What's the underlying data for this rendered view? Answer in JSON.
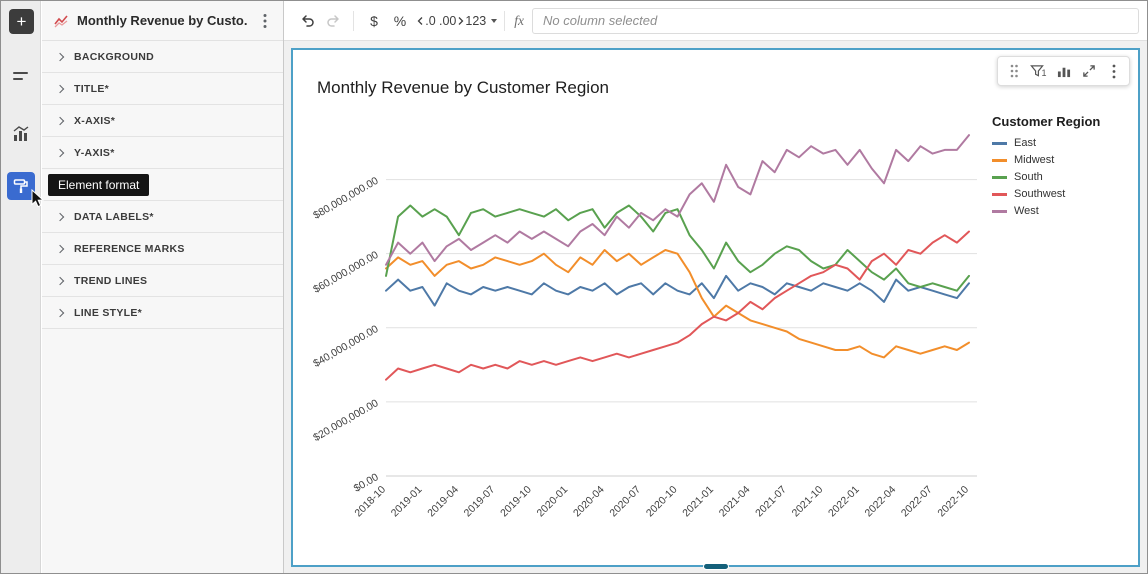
{
  "rail": {
    "add_label": "+",
    "tooltip": "Element format"
  },
  "panel": {
    "title": "Monthly Revenue by Custo...",
    "sections": [
      {
        "label": "BACKGROUND"
      },
      {
        "label": "TITLE*"
      },
      {
        "label": "X-AXIS*"
      },
      {
        "label": "Y-AXIS*"
      },
      {
        "label": ""
      },
      {
        "label": "DATA LABELS*"
      },
      {
        "label": "REFERENCE MARKS"
      },
      {
        "label": "TREND LINES"
      },
      {
        "label": "LINE STYLE*"
      }
    ]
  },
  "toolbar": {
    "currency_label": "$",
    "percent_label": "%",
    "decimal_decrease_label": ".0",
    "decimal_increase_label": ".00",
    "number_format_label": "123",
    "fx_label": "fx",
    "formula_placeholder": "No column selected"
  },
  "float_toolbar": {
    "filter_count": "1"
  },
  "colors": {
    "accent_blue": "#3a6bd0",
    "selection_border": "#4da0c7",
    "tooltip_bg": "#141414"
  },
  "chart_data": {
    "type": "line",
    "title": "Monthly Revenue by Customer Region",
    "legend_title": "Customer Region",
    "legend_position": "right",
    "grid": "horizontal",
    "x_tick_every": 3,
    "x_label_rotation": -45,
    "y_label_rotation": -30,
    "values_unit": "USD millions",
    "ylim": [
      0,
      95
    ],
    "x": [
      "2018-10",
      "2018-11",
      "2018-12",
      "2019-01",
      "2019-02",
      "2019-03",
      "2019-04",
      "2019-05",
      "2019-06",
      "2019-07",
      "2019-08",
      "2019-09",
      "2019-10",
      "2019-11",
      "2019-12",
      "2020-01",
      "2020-02",
      "2020-03",
      "2020-04",
      "2020-05",
      "2020-06",
      "2020-07",
      "2020-08",
      "2020-09",
      "2020-10",
      "2020-11",
      "2020-12",
      "2021-01",
      "2021-02",
      "2021-03",
      "2021-04",
      "2021-05",
      "2021-06",
      "2021-07",
      "2021-08",
      "2021-09",
      "2021-10",
      "2021-11",
      "2021-12",
      "2022-01",
      "2022-02",
      "2022-03",
      "2022-04",
      "2022-05",
      "2022-06",
      "2022-07",
      "2022-08",
      "2022-09",
      "2022-10"
    ],
    "y_ticks": [
      {
        "value": 0,
        "label": "$0.00"
      },
      {
        "value": 20,
        "label": "$20,000,000.00"
      },
      {
        "value": 40,
        "label": "$40,000,000.00"
      },
      {
        "value": 60,
        "label": "$60,000,000.00"
      },
      {
        "value": 80,
        "label": "$80,000,000.00"
      }
    ],
    "series": [
      {
        "name": "East",
        "color": "#4e79a7",
        "values": [
          50,
          53,
          50,
          51,
          46,
          52,
          50,
          49,
          51,
          50,
          51,
          50,
          49,
          52,
          50,
          49,
          51,
          50,
          52,
          49,
          51,
          52,
          49,
          52,
          50,
          49,
          52,
          48,
          54,
          50,
          52,
          51,
          49,
          52,
          51,
          50,
          52,
          51,
          50,
          52,
          50,
          47,
          53,
          50,
          51,
          50,
          49,
          48,
          52
        ]
      },
      {
        "name": "Midwest",
        "color": "#f28e2b",
        "values": [
          56,
          59,
          57,
          58,
          54,
          57,
          58,
          56,
          57,
          59,
          58,
          57,
          58,
          60,
          57,
          55,
          59,
          57,
          61,
          58,
          60,
          57,
          59,
          61,
          60,
          55,
          48,
          43,
          46,
          44,
          42,
          41,
          40,
          39,
          37,
          36,
          35,
          34,
          34,
          35,
          33,
          32,
          35,
          34,
          33,
          34,
          35,
          34,
          36
        ]
      },
      {
        "name": "South",
        "color": "#59a14f",
        "values": [
          54,
          70,
          73,
          70,
          72,
          70,
          65,
          71,
          72,
          70,
          71,
          72,
          71,
          70,
          72,
          69,
          71,
          72,
          67,
          71,
          73,
          70,
          66,
          71,
          72,
          65,
          61,
          56,
          63,
          58,
          55,
          57,
          60,
          62,
          61,
          58,
          56,
          57,
          61,
          58,
          55,
          53,
          56,
          52,
          51,
          52,
          51,
          50,
          54
        ]
      },
      {
        "name": "Southwest",
        "color": "#e15759",
        "values": [
          26,
          29,
          28,
          29,
          30,
          29,
          28,
          30,
          29,
          30,
          29,
          31,
          30,
          31,
          30,
          31,
          32,
          31,
          32,
          33,
          32,
          33,
          34,
          35,
          36,
          38,
          41,
          43,
          42,
          44,
          47,
          45,
          48,
          50,
          52,
          54,
          55,
          57,
          56,
          53,
          58,
          60,
          57,
          61,
          60,
          63,
          65,
          63,
          66
        ]
      },
      {
        "name": "West",
        "color": "#b07aa1",
        "values": [
          57,
          63,
          60,
          63,
          58,
          62,
          64,
          61,
          63,
          65,
          63,
          66,
          64,
          66,
          64,
          62,
          66,
          68,
          65,
          70,
          67,
          71,
          69,
          72,
          70,
          76,
          79,
          74,
          84,
          78,
          76,
          85,
          82,
          88,
          86,
          89,
          87,
          88,
          84,
          88,
          83,
          79,
          88,
          85,
          89,
          87,
          88,
          88,
          92
        ]
      }
    ]
  }
}
